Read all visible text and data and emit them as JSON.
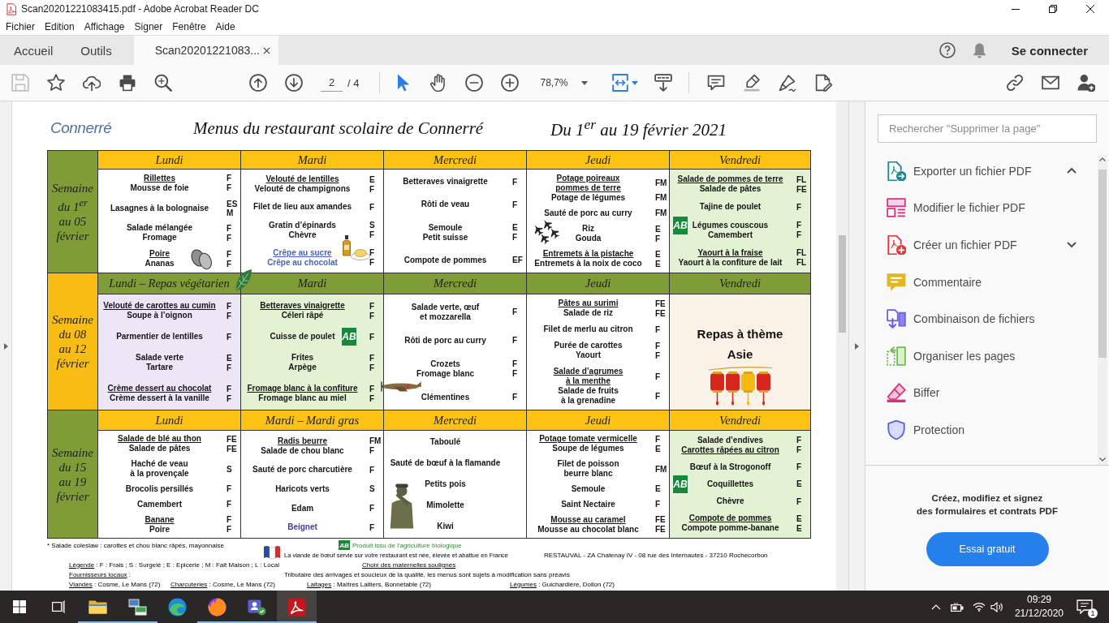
{
  "window": {
    "title": "Scan20201221083415.pdf - Adobe Acrobat Reader DC"
  },
  "menu": [
    "Fichier",
    "Edition",
    "Affichage",
    "Signer",
    "Fenêtre",
    "Aide"
  ],
  "tabs": [
    {
      "label": "Accueil",
      "selected": false,
      "closable": false
    },
    {
      "label": "Outils",
      "selected": false,
      "closable": false
    },
    {
      "label": "Scan20201221083...",
      "selected": true,
      "closable": true
    }
  ],
  "account": {
    "label": "Se connecter"
  },
  "toolbar": {
    "save": {
      "disabled": true
    },
    "page": "2",
    "page_total": "/ 4",
    "tools": [
      {
        "kind": "select",
        "selected": true
      },
      {
        "kind": "hand",
        "selected": false
      }
    ],
    "zoom": "78,7%"
  },
  "document": {
    "logo": "Connerré",
    "title": "Menus du restaurant scolaire de Connerré",
    "dates": "Du 1$^{er}$ au 19 février 2021",
    "weeks": [
      {
        "label": "Semaine\ndu 1$^{er}$\nau 05\nfévrier",
        "color": "#7f9c36",
        "header": {
          "color": "#fcc314"
        },
        "days": [
          {
            "name": "Lundi",
            "kind": "menu",
            "color": "#ffffff",
            "groups": [
              [
                {
                  "name": "Rillettes",
                  "underlined": true,
                  "code": "F"
                },
                {
                  "name": "Mousse de foie",
                  "underlined": false,
                  "code": "F"
                }
              ],
              [
                {
                  "name": "Lasagnes à la bolognaise",
                  "underlined": false,
                  "code": "ES\nM"
                }
              ],
              [
                {
                  "name": "Salade mélangée",
                  "underlined": false,
                  "code": "F"
                },
                {
                  "name": "Fromage",
                  "underlined": false,
                  "code": "F"
                }
              ],
              [
                {
                  "name": "Poire",
                  "underlined": true,
                  "code": "F"
                },
                {
                  "name": "Ananas",
                  "underlined": false,
                  "code": "F"
                }
              ]
            ]
          },
          {
            "name": "Mardi",
            "kind": "menu",
            "color": "#ffffff",
            "groups": [
              [
                {
                  "name": "Velouté de lentilles",
                  "underlined": true,
                  "code": "E"
                },
                {
                  "name": "Velouté de champignons",
                  "underlined": false,
                  "code": "F"
                }
              ],
              [
                {
                  "name": "Filet de lieu aux amandes",
                  "underlined": false,
                  "code": "F"
                }
              ],
              [
                {
                  "name": "Gratin d’épinards",
                  "underlined": false,
                  "code": "S"
                },
                {
                  "name": "Chèvre",
                  "underlined": false,
                  "code": "F"
                }
              ],
              [
                {
                  "name": "Crêpe au sucre",
                  "underlined": true,
                  "code": "F",
                  "color": "#4a62c4"
                },
                {
                  "name": "Crêpe au chocolat",
                  "underlined": false,
                  "code": "F",
                  "color": "#4a62c4"
                }
              ]
            ]
          },
          {
            "name": "Mercredi",
            "kind": "menu",
            "color": "#ffffff",
            "groups": [
              [
                {
                  "name": "Betteraves vinaigrette",
                  "underlined": false,
                  "code": "F"
                }
              ],
              [
                {
                  "name": "Rôti de veau",
                  "underlined": false,
                  "code": "F"
                }
              ],
              [
                {
                  "name": "Semoule",
                  "underlined": false,
                  "code": "E"
                },
                {
                  "name": "Petit suisse",
                  "underlined": false,
                  "code": "F"
                }
              ],
              [
                {
                  "name": "Compote de pommes",
                  "underlined": false,
                  "code": "EF"
                }
              ]
            ]
          },
          {
            "name": "Jeudi",
            "kind": "menu",
            "color": "#ffffff",
            "groups": [
              [
                {
                  "name": "Potage poireaux\npommes de terre",
                  "underlined": true,
                  "code": "FM"
                },
                {
                  "name": "Potage de légumes",
                  "underlined": false,
                  "code": "FM"
                }
              ],
              [
                {
                  "name": "Sauté de porc au curry",
                  "underlined": false,
                  "code": "FM"
                }
              ],
              [
                {
                  "name": "Riz",
                  "underlined": false,
                  "code": "E"
                },
                {
                  "name": "Gouda",
                  "underlined": false,
                  "code": "F"
                }
              ],
              [
                {
                  "name": "Entremets à la pistache",
                  "underlined": true,
                  "code": "E"
                },
                {
                  "name": "Entremets à la noix de coco",
                  "underlined": false,
                  "code": "E"
                }
              ]
            ]
          },
          {
            "name": "Vendredi",
            "kind": "menu",
            "color": "#e2f2d3",
            "groups": [
              [
                {
                  "name": "Salade de pommes de terre",
                  "underlined": true,
                  "code": "FL"
                },
                {
                  "name": "Salade de pâtes",
                  "underlined": false,
                  "code": "FE"
                }
              ],
              [
                {
                  "name": "Tajine de poulet",
                  "underlined": false,
                  "code": "F"
                }
              ],
              [
                {
                  "name": "Légumes couscous",
                  "underlined": false,
                  "code": "F",
                  "organic_logo": "AB"
                },
                {
                  "name": "Camembert",
                  "underlined": false,
                  "code": "F"
                }
              ],
              [
                {
                  "name": "Yaourt à la fraise",
                  "underlined": true,
                  "code": "FL"
                },
                {
                  "name": "Yaourt à la confiture de lait",
                  "underlined": false,
                  "code": "FL"
                }
              ]
            ]
          }
        ]
      },
      {
        "label": "Semaine\ndu 08\nau 12\nfévrier",
        "color": "#f8bc12",
        "header": {
          "color": "#7f9c36"
        },
        "days": [
          {
            "name": "Lundi – Repas végétarien",
            "kind": "menu",
            "color": "#ece6f6",
            "groups": [
              [
                {
                  "name": "Velouté de carottes au cumin",
                  "underlined": true,
                  "code": "F"
                },
                {
                  "name": "Soupe à l’oignon",
                  "underlined": false,
                  "code": "F"
                }
              ],
              [
                {
                  "name": "Parmentier de lentilles",
                  "underlined": false,
                  "code": "F"
                }
              ],
              [
                {
                  "name": "Salade verte",
                  "underlined": false,
                  "code": "E"
                },
                {
                  "name": "Tartare",
                  "underlined": false,
                  "code": "F"
                }
              ],
              [
                {
                  "name": "Crème dessert au chocolat",
                  "underlined": true,
                  "code": "F"
                },
                {
                  "name": "Crème dessert à la vanille",
                  "underlined": false,
                  "code": "F"
                }
              ]
            ]
          },
          {
            "name": "Mardi",
            "kind": "menu",
            "color": "#e2f2d3",
            "groups": [
              [
                {
                  "name": "Betteraves vinaigrette",
                  "underlined": true,
                  "code": "F"
                },
                {
                  "name": "Céleri râpé",
                  "underlined": false,
                  "code": "F"
                }
              ],
              [
                {
                  "name": "Cuisse de poulet",
                  "underlined": false,
                  "code": "F",
                  "organic_logo": "AB"
                }
              ],
              [
                {
                  "name": "Frites",
                  "underlined": false,
                  "code": "F"
                },
                {
                  "name": "Arpège",
                  "underlined": false,
                  "code": "F"
                }
              ],
              [
                {
                  "name": "Fromage blanc à la confiture",
                  "underlined": true,
                  "code": "F"
                },
                {
                  "name": "Fromage blanc au miel",
                  "underlined": false,
                  "code": "F"
                }
              ]
            ]
          },
          {
            "name": "Mercredi",
            "kind": "menu",
            "color": "#ffffff",
            "groups": [
              [
                {
                  "name": "Salade verte, œuf\net mozzarella",
                  "underlined": false,
                  "code": "F"
                }
              ],
              [
                {
                  "name": "Rôti de porc au curry",
                  "underlined": false,
                  "code": "F"
                }
              ],
              [
                {
                  "name": "Crozets",
                  "underlined": false,
                  "code": "F"
                },
                {
                  "name": "Fromage blanc",
                  "underlined": false,
                  "code": "F"
                }
              ],
              [
                {
                  "name": "Clémentines",
                  "underlined": false,
                  "code": "F"
                }
              ]
            ]
          },
          {
            "name": "Jeudi",
            "kind": "menu",
            "color": "#ffffff",
            "groups": [
              [
                {
                  "name": "Pâtes au surimi",
                  "underlined": true,
                  "code": "FE"
                },
                {
                  "name": "Salade de riz",
                  "underlined": false,
                  "code": "FE"
                }
              ],
              [
                {
                  "name": "Filet de merlu au citron",
                  "underlined": false,
                  "code": "F"
                }
              ],
              [
                {
                  "name": "Purée de carottes",
                  "underlined": false,
                  "code": "F"
                },
                {
                  "name": "Yaourt",
                  "underlined": false,
                  "code": "F"
                }
              ],
              [
                {
                  "name": "Salade d’agrumes\nà la menthe",
                  "underlined": true,
                  "code": "F"
                },
                {
                  "name": "Salade de fruits\nà la grenadine",
                  "underlined": false,
                  "code": "F"
                }
              ]
            ]
          },
          {
            "name": "Vendredi",
            "kind": "theme",
            "color": "#faf1e7",
            "theme": "Repas à thème\nAsie"
          }
        ]
      },
      {
        "label": "Semaine\ndu 15\nau 19\nfévrier",
        "color": "#7f9c36",
        "header": {
          "color": "#fcc314"
        },
        "days": [
          {
            "name": "Lundi",
            "kind": "menu",
            "color": "#ffffff",
            "groups": [
              [
                {
                  "name": "Salade de blé au thon",
                  "underlined": true,
                  "code": "FE"
                },
                {
                  "name": "Salade de pâtes",
                  "underlined": false,
                  "code": "FE"
                }
              ],
              [
                {
                  "name": "Haché de veau\nà la provençale",
                  "underlined": false,
                  "code": "S"
                }
              ],
              [
                {
                  "name": "Brocolis persillés",
                  "underlined": false,
                  "code": "F"
                }
              ],
              [
                {
                  "name": "Camembert",
                  "underlined": false,
                  "code": "F"
                }
              ],
              [
                {
                  "name": "Banane",
                  "underlined": true,
                  "code": "F"
                },
                {
                  "name": "Poire",
                  "underlined": false,
                  "code": "F"
                }
              ]
            ]
          },
          {
            "name": "Mardi – Mardi gras",
            "kind": "menu",
            "color": "#ffffff",
            "groups": [
              [
                {
                  "name": "Radis beurre",
                  "underlined": true,
                  "code": "FM"
                },
                {
                  "name": "Salade de chou blanc",
                  "underlined": false,
                  "code": "F"
                }
              ],
              [
                {
                  "name": "Sauté de porc charcutière",
                  "underlined": false,
                  "code": "F"
                }
              ],
              [
                {
                  "name": "Haricots verts",
                  "underlined": false,
                  "code": "S"
                }
              ],
              [
                {
                  "name": "Edam",
                  "underlined": false,
                  "code": "F"
                }
              ],
              [
                {
                  "name": "Beignet",
                  "underlined": false,
                  "code": "F",
                  "color": "#3f3d9c"
                }
              ]
            ]
          },
          {
            "name": "Mercredi",
            "kind": "menu",
            "color": "#ffffff",
            "groups": [
              [
                {
                  "name": "Taboulé",
                  "underlined": false
                }
              ],
              [
                {
                  "name": "Sauté de bœuf à la flamande",
                  "underlined": false
                }
              ],
              [
                {
                  "name": "Petits pois",
                  "underlined": false
                }
              ],
              [
                {
                  "name": "Mimolette",
                  "underlined": false
                }
              ],
              [
                {
                  "name": "Kiwi",
                  "underlined": false
                }
              ]
            ]
          },
          {
            "name": "Jeudi",
            "kind": "menu",
            "color": "#ffffff",
            "groups": [
              [
                {
                  "name": "Potage tomate vermicelle",
                  "underlined": true,
                  "code": "F"
                },
                {
                  "name": "Soupe de légumes",
                  "underlined": false,
                  "code": "E"
                }
              ],
              [
                {
                  "name": "Filet de poisson\nbeurre blanc",
                  "underlined": false,
                  "code": "FM"
                }
              ],
              [
                {
                  "name": "Semoule",
                  "underlined": false,
                  "code": "E"
                }
              ],
              [
                {
                  "name": "Saint Nectaire",
                  "underlined": false,
                  "code": "F"
                }
              ],
              [
                {
                  "name": "Mousse au caramel",
                  "underlined": true,
                  "code": "FE"
                },
                {
                  "name": "Mousse au chocolat blanc",
                  "underlined": false,
                  "code": "FE"
                }
              ]
            ]
          },
          {
            "name": "Vendredi",
            "kind": "menu",
            "color": "#e2f2d3",
            "groups": [
              [
                {
                  "name": "Salade d’endives",
                  "underlined": false,
                  "code": "F"
                },
                {
                  "name": "Carottes râpées au citron",
                  "underlined": true,
                  "code": "F"
                }
              ],
              [
                {
                  "name": "Bœuf à la Strogonoff",
                  "underlined": false,
                  "code": "F"
                }
              ],
              [
                {
                  "name": "Coquillettes",
                  "underlined": false,
                  "code": "E",
                  "organic_logo": "AB"
                }
              ],
              [
                {
                  "name": "Chèvre",
                  "underlined": false,
                  "code": "F"
                }
              ],
              [
                {
                  "name": "Compote de pommes",
                  "underlined": true,
                  "code": "E"
                },
                {
                  "name": "Compote pomme-banane",
                  "underlined": false,
                  "code": "E"
                }
              ]
            ]
          }
        ]
      }
    ],
    "footer": {
      "note": "* Salade coleslaw : carottes et chou blanc râpés, mayonnaise",
      "organic": {
        "logo": "AB",
        "text": "Produit issu de l'agriculture biologique"
      },
      "beef": "La viande de bœuf servie sur votre restaurant est née, élevée et abattue en France",
      "address": "RESTAUVAL - ZA Chatenay IV - 08 rue des Internautes - 37210 Rochecorbon",
      "legend": {
        "label": "Légende",
        "text": " : F : Frais ; S : Surgelé ; E : Epicerie ; M : Fait Maison ; L : Local"
      },
      "choice": "Choix des maternelles soulignés",
      "suppliers_title": {
        "label": "Fournisseurs locaux",
        "text": " :"
      },
      "disclaimer": "Tributaire des arrivages et soucieux de la qualité, les menus sont sujets à modification sans préavis",
      "suppliers": [
        {
          "label": "Viandes",
          "text": " : Cosme, Le Mans (72)"
        },
        {
          "label": "Charcuteries",
          "text": " : Cosme, Le Mans (72)"
        },
        {
          "label": "Laitages",
          "text": " : Maîtres Laitiers, Bonnétable (72)"
        },
        {
          "label": "Légumes",
          "text": " : Guichardière, Dollon (72)"
        }
      ]
    }
  },
  "tools_panel": {
    "search": {
      "placeholder": "Rechercher \"Supprimer la page\""
    },
    "items": [
      {
        "label": "Exporter un fichier PDF",
        "kind": "section",
        "expanded": true
      },
      {
        "label": "Modifier le fichier PDF",
        "kind": "tool"
      },
      {
        "label": "Créer un fichier PDF",
        "kind": "section",
        "expanded": false
      },
      {
        "label": "Commentaire",
        "kind": "tool"
      },
      {
        "label": "Combinaison de fichiers",
        "kind": "tool"
      },
      {
        "label": "Organiser les pages",
        "kind": "tool"
      },
      {
        "label": "Biffer",
        "kind": "tool"
      },
      {
        "label": "Protection",
        "kind": "tool"
      }
    ],
    "promo": "Créez, modifiez et signez\ndes formulaires et contrats PDF",
    "button": "Essai gratuit"
  },
  "taskbar": {
    "apps": [
      {
        "kind": "folder",
        "running": true,
        "selected": false
      },
      {
        "kind": "network",
        "running": true,
        "selected": false
      },
      {
        "kind": "wave",
        "running": false,
        "selected": false
      },
      {
        "kind": "globe",
        "running": true,
        "selected": false
      },
      {
        "kind": "chat",
        "running": true,
        "selected": false
      },
      {
        "kind": "pdf",
        "running": true,
        "selected": true
      }
    ],
    "time": "09:29",
    "date": "21/12/2020",
    "notifications": "1"
  }
}
